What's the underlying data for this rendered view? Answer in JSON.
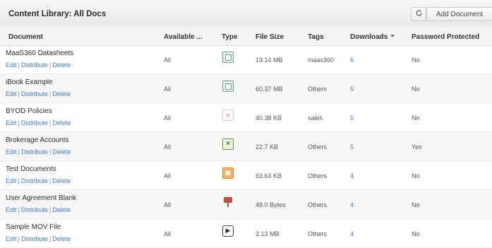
{
  "header": {
    "title": "Content Library: All Docs",
    "add_label": "Add Document",
    "refresh_icon": "refresh-icon"
  },
  "columns": {
    "document": "Document",
    "available": "Available ...",
    "type": "Type",
    "file_size": "File Size",
    "tags": "Tags",
    "downloads": "Downloads",
    "password": "Password Protected"
  },
  "action_labels": {
    "edit": "Edit",
    "distribute": "Distribute",
    "delete": "Delete",
    "sep": "|"
  },
  "rows": [
    {
      "name": "MaaS360 Datasheets",
      "available": "All",
      "type_icon": "document-icon",
      "size": "19.14 MB",
      "tags": "maas360",
      "downloads": "6",
      "password": "No"
    },
    {
      "name": "iBook Example",
      "available": "All",
      "type_icon": "document-icon",
      "size": "60.37 MB",
      "tags": "Others",
      "downloads": "5",
      "password": "No"
    },
    {
      "name": "BYOD Policies",
      "available": "All",
      "type_icon": "pdf-icon",
      "size": "40.38 KB",
      "tags": "sales",
      "downloads": "5",
      "password": "No"
    },
    {
      "name": "Brokerage Accounts",
      "available": "All",
      "type_icon": "spreadsheet-icon",
      "size": "22.7 KB",
      "tags": "Others",
      "downloads": "5",
      "password": "Yes"
    },
    {
      "name": "Test Documents",
      "available": "All",
      "type_icon": "presentation-icon",
      "size": "63.64 KB",
      "tags": "Others",
      "downloads": "4",
      "password": "No"
    },
    {
      "name": "User Agreement Blank",
      "available": "All",
      "type_icon": "keynote-icon",
      "size": "48.0 Bytes",
      "tags": "Others",
      "downloads": "4",
      "password": "No"
    },
    {
      "name": "Sample MOV File",
      "available": "All",
      "type_icon": "video-icon",
      "size": "3.13 MB",
      "tags": "Others",
      "downloads": "4",
      "password": "No"
    }
  ],
  "colors": {
    "link": "#3a7bbf",
    "header_bg": "#f3f3f3"
  }
}
